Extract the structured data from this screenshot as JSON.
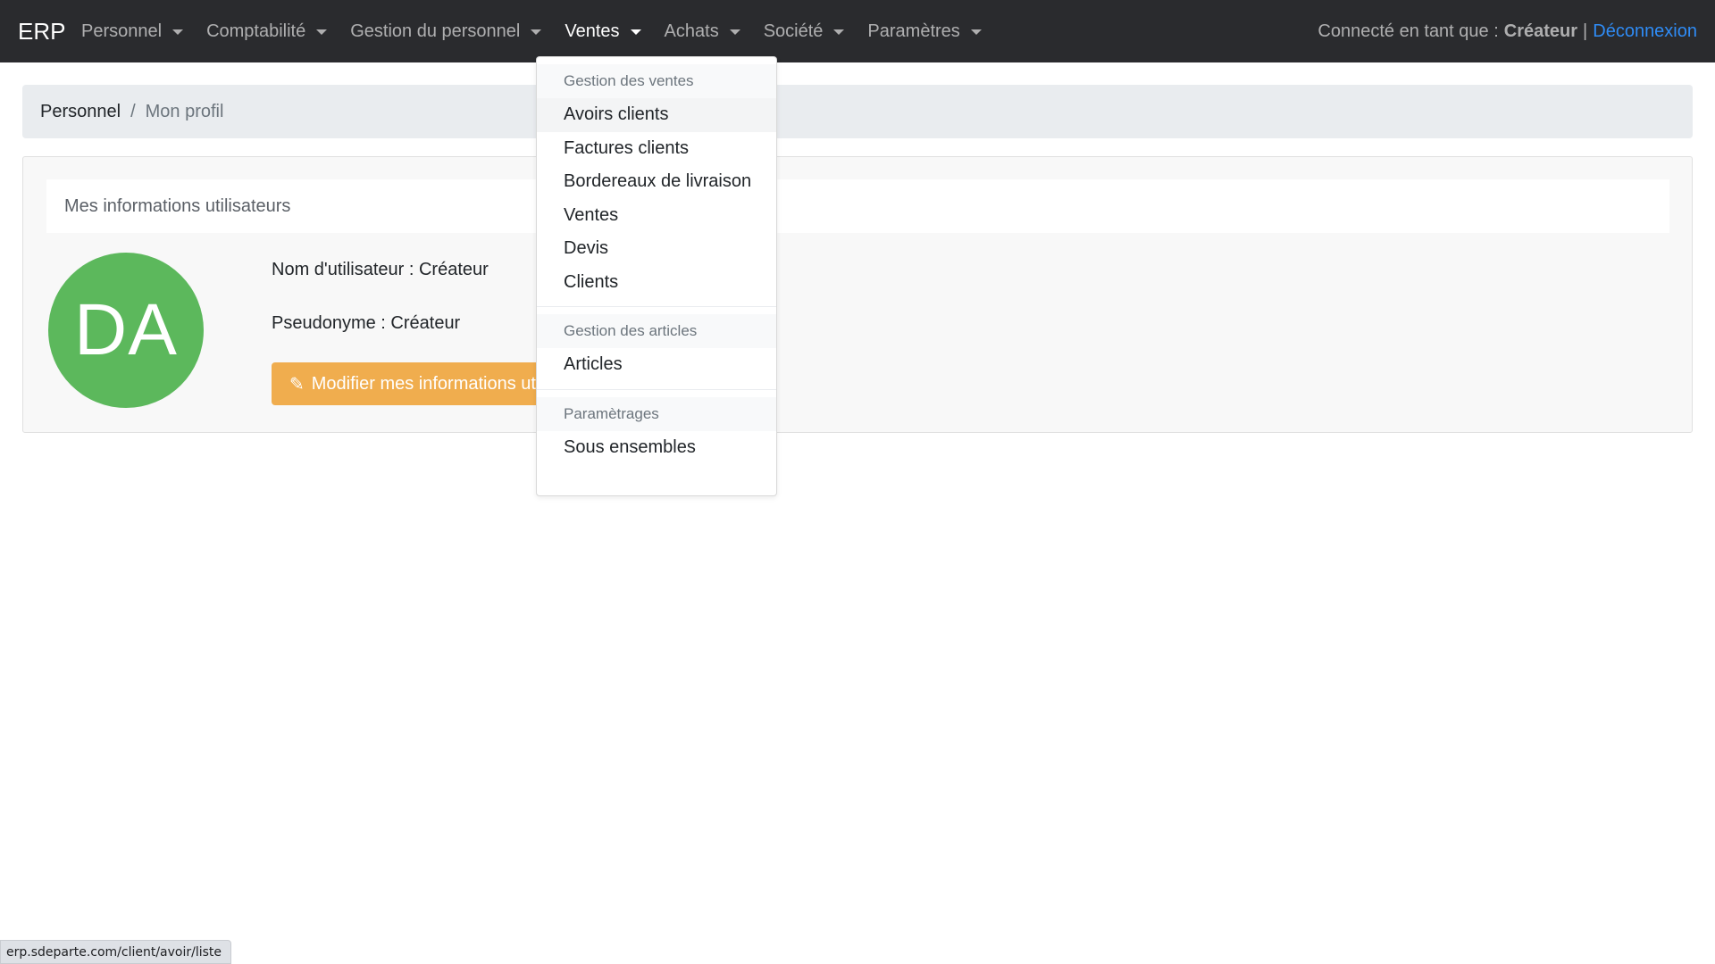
{
  "navbar": {
    "brand": "ERP",
    "items": [
      {
        "label": "Personnel"
      },
      {
        "label": "Comptabilité"
      },
      {
        "label": "Gestion du personnel"
      },
      {
        "label": "Ventes"
      },
      {
        "label": "Achats"
      },
      {
        "label": "Société"
      },
      {
        "label": "Paramètres"
      }
    ],
    "active_item": "Ventes",
    "user": {
      "prefix": "Connecté en tant que :",
      "name": "Créateur",
      "separator": "|",
      "logout_label": "Déconnexion"
    }
  },
  "breadcrumb": {
    "parent": "Personnel",
    "separator": "/",
    "current": "Mon profil"
  },
  "profile": {
    "card_title": "Mes informations utilisateurs",
    "avatar_initials": "DA",
    "avatar_color": "#5cb85c",
    "username_line": "Nom d'utilisateur : Créateur",
    "nickname_line": "Pseudonyme : Créateur",
    "edit_button_label": "Modifier mes informations utilisateurs",
    "edit_button_color": "#f0ad4e"
  },
  "dropdown": {
    "sections": [
      {
        "header": "Gestion des ventes",
        "items": [
          "Avoirs clients",
          "Factures clients",
          "Bordereaux de livraison",
          "Ventes",
          "Devis",
          "Clients"
        ]
      },
      {
        "header": "Gestion des articles",
        "items": [
          "Articles"
        ]
      },
      {
        "header": "Paramètrages",
        "items": [
          "Sous ensembles"
        ]
      }
    ],
    "hovered_item": "Avoirs clients"
  },
  "status_bar": {
    "url": "erp.sdeparte.com/client/avoir/liste"
  },
  "colors": {
    "navbar_bg": "#2a2b2e",
    "link": "#2f8cf6",
    "breadcrumb_bg": "#e9ecef"
  }
}
